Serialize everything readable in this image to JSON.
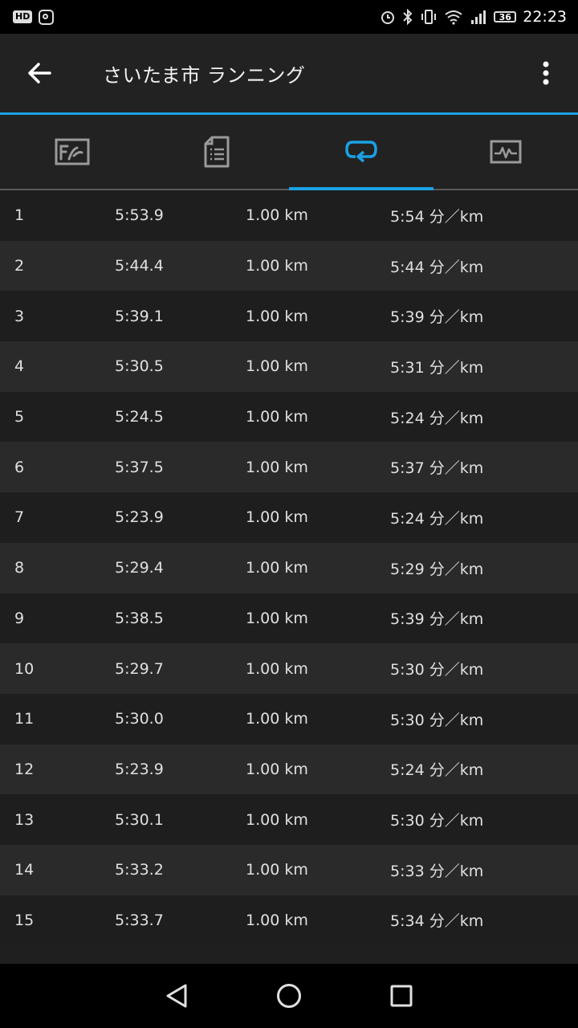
{
  "status_bar": {
    "hd_label": "HD",
    "battery": "36",
    "time": "22:23"
  },
  "toolbar": {
    "title": "さいたま市 ランニング"
  },
  "tabs": [
    {
      "icon": "summary-chart-icon",
      "active": false
    },
    {
      "icon": "details-document-icon",
      "active": false
    },
    {
      "icon": "laps-loop-icon",
      "active": true
    },
    {
      "icon": "activity-graph-icon",
      "active": false
    }
  ],
  "laps": [
    {
      "lap": "1",
      "time": "5:53.9",
      "distance": "1.00 km",
      "pace": "5:54 分／km"
    },
    {
      "lap": "2",
      "time": "5:44.4",
      "distance": "1.00 km",
      "pace": "5:44 分／km"
    },
    {
      "lap": "3",
      "time": "5:39.1",
      "distance": "1.00 km",
      "pace": "5:39 分／km"
    },
    {
      "lap": "4",
      "time": "5:30.5",
      "distance": "1.00 km",
      "pace": "5:31 分／km"
    },
    {
      "lap": "5",
      "time": "5:24.5",
      "distance": "1.00 km",
      "pace": "5:24 分／km"
    },
    {
      "lap": "6",
      "time": "5:37.5",
      "distance": "1.00 km",
      "pace": "5:37 分／km"
    },
    {
      "lap": "7",
      "time": "5:23.9",
      "distance": "1.00 km",
      "pace": "5:24 分／km"
    },
    {
      "lap": "8",
      "time": "5:29.4",
      "distance": "1.00 km",
      "pace": "5:29 分／km"
    },
    {
      "lap": "9",
      "time": "5:38.5",
      "distance": "1.00 km",
      "pace": "5:39 分／km"
    },
    {
      "lap": "10",
      "time": "5:29.7",
      "distance": "1.00 km",
      "pace": "5:30 分／km"
    },
    {
      "lap": "11",
      "time": "5:30.0",
      "distance": "1.00 km",
      "pace": "5:30 分／km"
    },
    {
      "lap": "12",
      "time": "5:23.9",
      "distance": "1.00 km",
      "pace": "5:24 分／km"
    },
    {
      "lap": "13",
      "time": "5:30.1",
      "distance": "1.00 km",
      "pace": "5:30 分／km"
    },
    {
      "lap": "14",
      "time": "5:33.2",
      "distance": "1.00 km",
      "pace": "5:33 分／km"
    },
    {
      "lap": "15",
      "time": "5:33.7",
      "distance": "1.00 km",
      "pace": "5:34 分／km"
    }
  ],
  "colors": {
    "accent": "#1aa1e5",
    "background": "#1f1f1f",
    "row_alt": "#2a2a2a"
  }
}
